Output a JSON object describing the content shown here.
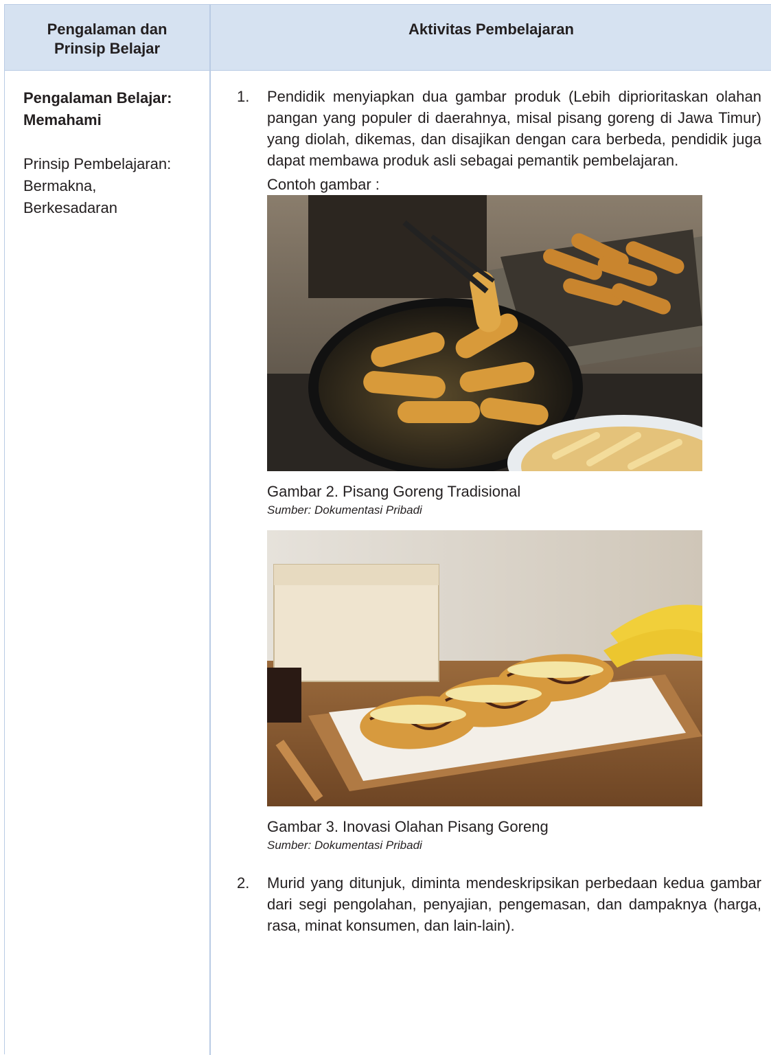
{
  "header": {
    "left_line1": "Pengalaman dan",
    "left_line2": "Prinsip Belajar",
    "right": "Aktivitas Pembelajaran"
  },
  "left": {
    "experience_line1": "Pengalaman Belajar:",
    "experience_line2": "Memahami",
    "principle_line1": "Prinsip Pembelajaran:",
    "principle_line2": "Bermakna,",
    "principle_line3": "Berkesadaran"
  },
  "items": [
    {
      "number": "1.",
      "text": "Pendidik menyiapkan dua gambar produk (Lebih diprioritaskan olahan pangan yang populer di daerahnya, misal pisang goreng di Jawa Timur) yang diolah, dikemas, dan disajikan dengan cara berbeda, pendidik juga dapat membawa produk asli sebagai pemantik pembelajaran.",
      "example_label": "Contoh gambar :"
    },
    {
      "number": "2.",
      "text": "Murid yang ditunjuk, diminta mendeskripsikan perbedaan kedua gambar dari segi pengolahan, penyajian, pengemasan, dan dampaknya (harga, rasa, minat konsumen, dan lain-lain)."
    }
  ],
  "figures": [
    {
      "caption": "Gambar 2. Pisang Goreng Tradisional",
      "source": "Sumber: Dokumentasi Pribadi"
    },
    {
      "caption": "Gambar 3. Inovasi Olahan Pisang Goreng",
      "source": "Sumber: Dokumentasi Pribadi"
    }
  ]
}
